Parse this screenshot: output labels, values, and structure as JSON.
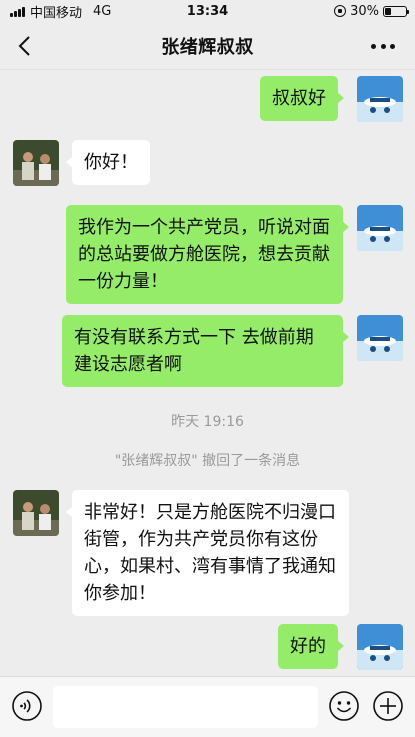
{
  "status": {
    "carrier": "中国移动",
    "network": "4G",
    "time": "13:34",
    "battery": "30%",
    "battery_level": 0.3
  },
  "header": {
    "title": "张绪辉叔叔"
  },
  "messages": [
    {
      "sender": "me",
      "text": "叔叔好"
    },
    {
      "sender": "other",
      "text": "你好！"
    },
    {
      "sender": "me",
      "text": "我作为一个共产党员，听说对面的总站要做方舱医院，想去贡献一份力量！"
    },
    {
      "sender": "me",
      "text": "有没有联系方式一下 去做前期建设志愿者啊"
    },
    {
      "sender": "other",
      "text": "非常好！只是方舱医院不归漫口街管，作为共产党员你有这份心，如果村、湾有事情了我通知你参加！"
    },
    {
      "sender": "me",
      "text": "好的"
    }
  ],
  "timestamp": "昨天 19:16",
  "recall_notice": "\"张绪辉叔叔\" 撤回了一条消息",
  "input": {
    "value": "",
    "placeholder": ""
  },
  "colors": {
    "background": "#ededed",
    "my_bubble": "#95ec69",
    "other_bubble": "#ffffff"
  }
}
